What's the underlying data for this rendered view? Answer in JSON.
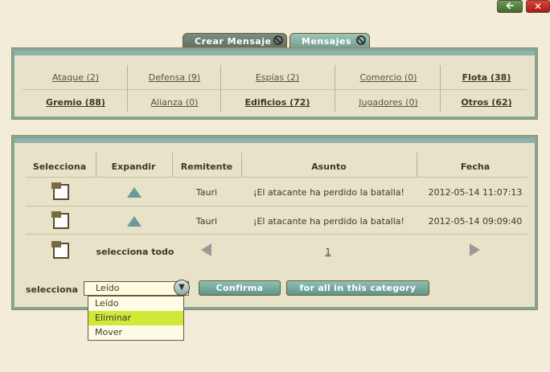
{
  "window": {
    "back_glyph": "🡨",
    "close_glyph": "✕"
  },
  "tabs": [
    {
      "label": "Crear Mensaje"
    },
    {
      "label": "Mensajes"
    }
  ],
  "categories": {
    "row1": [
      "Ataque (2)",
      "Defensa (9)",
      "Espías (2)",
      "Comercio (0)",
      "Flota (38)"
    ],
    "row2": [
      "Gremio (88)",
      "Alianza (0)",
      "Edificios (72)",
      "Jugadores (0)",
      "Otros (62)"
    ]
  },
  "table": {
    "headers": [
      "Selecciona",
      "Expandir",
      "Remitente",
      "Asunto",
      "Fecha"
    ],
    "rows": [
      {
        "sender": "Tauri",
        "subject": "¡El atacante ha perdido la batalla!",
        "date": "2012-05-14 11:07:13"
      },
      {
        "sender": "Tauri",
        "subject": "¡El atacante ha perdido la batalla!",
        "date": "2012-05-14 09:09:40"
      }
    ],
    "select_all_label": "selecciona todo",
    "page_number": "1"
  },
  "actions": {
    "select_label": "selecciona",
    "selected_option": "Leído",
    "options": [
      "Leído",
      "Eliminar",
      "Mover"
    ],
    "highlighted_option": "Eliminar",
    "confirm_label": "Confirma",
    "category_label": "for all in this category"
  }
}
